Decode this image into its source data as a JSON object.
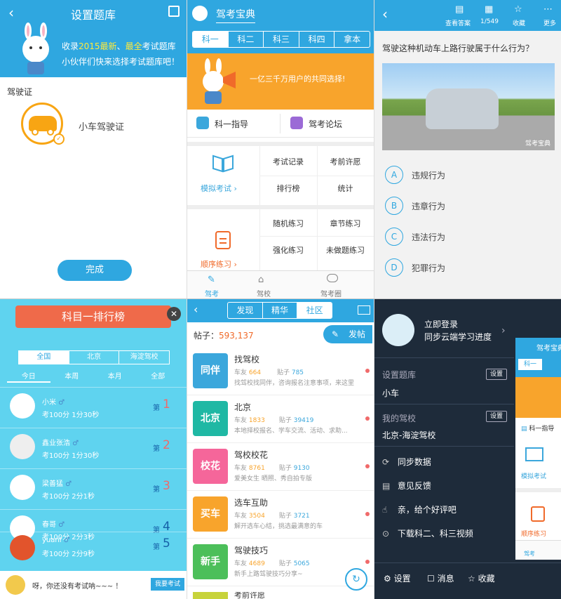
{
  "colors": {
    "primary": "#2fa7e0",
    "orange": "#f8a42c",
    "red": "#ef6a4a"
  },
  "p1": {
    "title": "设置题库",
    "banner_line1_pre": "收录",
    "banner_line1_hl1": "2015最新",
    "banner_line1_sep": "、",
    "banner_line1_hl2": "最全",
    "banner_line1_post": "考试题库",
    "banner_line2": "小伙伴们快来选择考试题库吧！",
    "section": "驾驶证",
    "car_label": "小车驾驶证",
    "done": "完成"
  },
  "p2": {
    "app_name": "驾考宝典",
    "tabs": [
      "科一",
      "科二",
      "科三",
      "科四",
      "拿本"
    ],
    "slogan": "一亿三千万用户的共同选择!",
    "guide": "科一指导",
    "forum": "驾考论坛",
    "mock_exam": "模拟考试",
    "cells1": [
      "考试记录",
      "考前许愿",
      "排行榜",
      "统计"
    ],
    "seq_practice": "顺序练习",
    "cells2": [
      "随机练习",
      "章节练习",
      "强化练习",
      "未做题练习"
    ],
    "nav": [
      "驾考",
      "驾校",
      "驾考圈"
    ]
  },
  "p3": {
    "header": [
      "查看答案",
      "1/549",
      "收藏",
      "更多"
    ],
    "question": "驾驶这种机动车上路行驶属于什么行为？",
    "watermark": "驾考宝典",
    "options": [
      {
        "letter": "A",
        "text": "违规行为"
      },
      {
        "letter": "B",
        "text": "违章行为"
      },
      {
        "letter": "C",
        "text": "违法行为"
      },
      {
        "letter": "D",
        "text": "犯罪行为"
      }
    ]
  },
  "p4": {
    "title": "科目一排行榜",
    "regions": [
      "全国",
      "北京",
      "海淀驾校"
    ],
    "periods": [
      "今日",
      "本周",
      "本月",
      "全部"
    ],
    "rank_prefix": "第",
    "users": [
      {
        "name": "小米",
        "score": "考100分  1分30秒",
        "rank": "1",
        "color": "#f06a6a"
      },
      {
        "name": "鑫业张浩",
        "score": "考100分  1分30秒",
        "rank": "2",
        "color": "#f06a6a"
      },
      {
        "name": "梁善猛",
        "score": "考100分  2分1秒",
        "rank": "3",
        "color": "#f06a6a"
      },
      {
        "name": "春哥",
        "score": "考100分  2分3秒",
        "rank": "4",
        "color": "#1560a8"
      },
      {
        "name": "yuanl",
        "score": "考100分  2分9秒",
        "rank": "5",
        "color": "#1560a8"
      }
    ],
    "footer_msg": "呀，你还没有考试呐~~~ ！",
    "exam_btn": "我要考试"
  },
  "p5": {
    "tabs": [
      "发现",
      "精华",
      "社区"
    ],
    "posts_label": "帖子：",
    "posts_count": "593,137",
    "post_btn": "发帖",
    "car_friend": "车友",
    "posts": "贴子",
    "rows": [
      {
        "badge": "同伴",
        "color": "#3ba7dc",
        "title": "找驾校",
        "friends": "664",
        "posts": "785",
        "desc": "找驾校找同伴，咨询报名注意事项，来这里"
      },
      {
        "badge": "北京",
        "color": "#1fb8a4",
        "title": "北京",
        "friends": "1833",
        "posts": "39419",
        "desc": "本地择校报名、学车交流、活动、求助..."
      },
      {
        "badge": "校花",
        "color": "#f5669a",
        "title": "驾校校花",
        "friends": "8761",
        "posts": "9130",
        "desc": "爱美女生 晒照、秀自拍专版"
      },
      {
        "badge": "买车",
        "color": "#f8a42c",
        "title": "选车互助",
        "friends": "3504",
        "posts": "3721",
        "desc": "解开选车心结，挑选最满意的车"
      },
      {
        "badge": "新手",
        "color": "#4cbf5a",
        "title": "驾驶技巧",
        "friends": "4689",
        "posts": "5065",
        "desc": "新手上路驾驶技巧分享~"
      }
    ],
    "partial": "考前许愿"
  },
  "p6": {
    "login": "立即登录",
    "sync_progress": "同步云端学习进度",
    "set_bank": "设置题库",
    "bank_value": "小车",
    "set": "设置",
    "my_school": "我的驾校",
    "school_value": "北京-海淀驾校",
    "items": [
      "同步数据",
      "意见反馈",
      "亲，给个好评吧",
      "下载科二、科三视频"
    ],
    "bottom": [
      "设置",
      "消息",
      "收藏"
    ],
    "mini_title": "驾考宝典",
    "mini_tab": "科一",
    "mini_guide": "科一指导",
    "mini_mock": "模拟考试",
    "mini_seq": "顺序练习",
    "mini_nav": "驾考"
  }
}
